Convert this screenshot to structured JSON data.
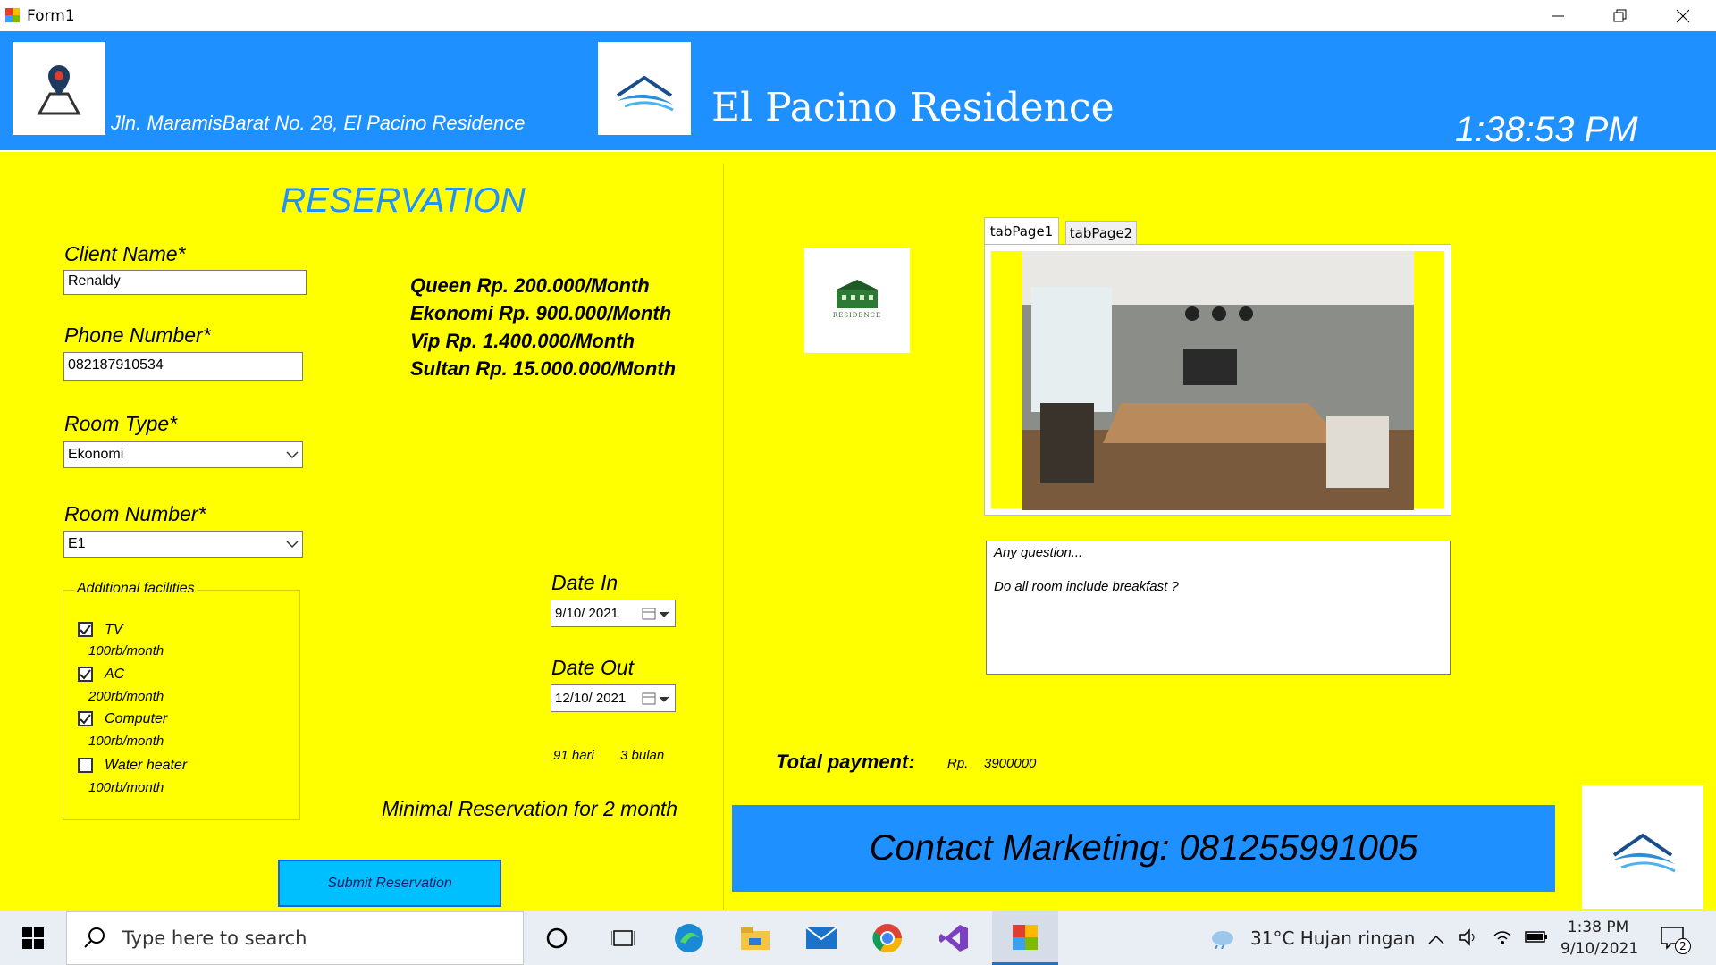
{
  "window": {
    "title": "Form1"
  },
  "header": {
    "address": "Jln. MaramisBarat No. 28, El Pacino Residence",
    "brand": "El Pacino Residence",
    "clock": "1:38:53 PM"
  },
  "form": {
    "heading": "RESERVATION",
    "client_name": {
      "label": "Client Name*",
      "value": "Renaldy"
    },
    "phone": {
      "label": "Phone Number*",
      "value": "082187910534"
    },
    "room_type": {
      "label": "Room Type*",
      "value": "Ekonomi"
    },
    "room_number": {
      "label": "Room Number*",
      "value": "E1"
    },
    "facilities": {
      "title": "Additional facilities",
      "items": [
        {
          "name": "TV",
          "price": "100rb/month",
          "checked": true
        },
        {
          "name": "AC",
          "price": "200rb/month",
          "checked": true
        },
        {
          "name": "Computer",
          "price": "100rb/month",
          "checked": true
        },
        {
          "name": "Water heater",
          "price": "100rb/month",
          "checked": false
        }
      ]
    },
    "prices": [
      "Queen Rp. 200.000/Month",
      "Ekonomi Rp. 900.000/Month",
      "Vip Rp. 1.400.000/Month",
      "Sultan Rp. 15.000.000/Month"
    ],
    "date_in": {
      "label": "Date In",
      "value": "9/10/ 2021"
    },
    "date_out": {
      "label": "Date Out",
      "value": "12/10/ 2021"
    },
    "days": "91 hari",
    "months": "3 bulan",
    "minimal_note": "Minimal Reservation for 2 month",
    "submit_label": "Submit Reservation"
  },
  "right": {
    "residence_logo_text": "RESIDENCE",
    "tabs": [
      "tabPage1",
      "tabPage2"
    ],
    "question_title": "Any question...",
    "question_text": "Do all room include breakfast ?",
    "total_label": "Total payment:",
    "total_currency": "Rp.",
    "total_value": "3900000",
    "contact": "Contact Marketing: 081255991005"
  },
  "taskbar": {
    "search_placeholder": "Type here to search",
    "weather": "31°C  Hujan ringan",
    "time": "1:38 PM",
    "date": "9/10/2021",
    "notifications": "2"
  },
  "colors": {
    "header_blue": "#1e90ff",
    "form_yellow": "#ffff00",
    "heading_blue": "#1e90ff",
    "submit_cyan": "#00bfff"
  }
}
